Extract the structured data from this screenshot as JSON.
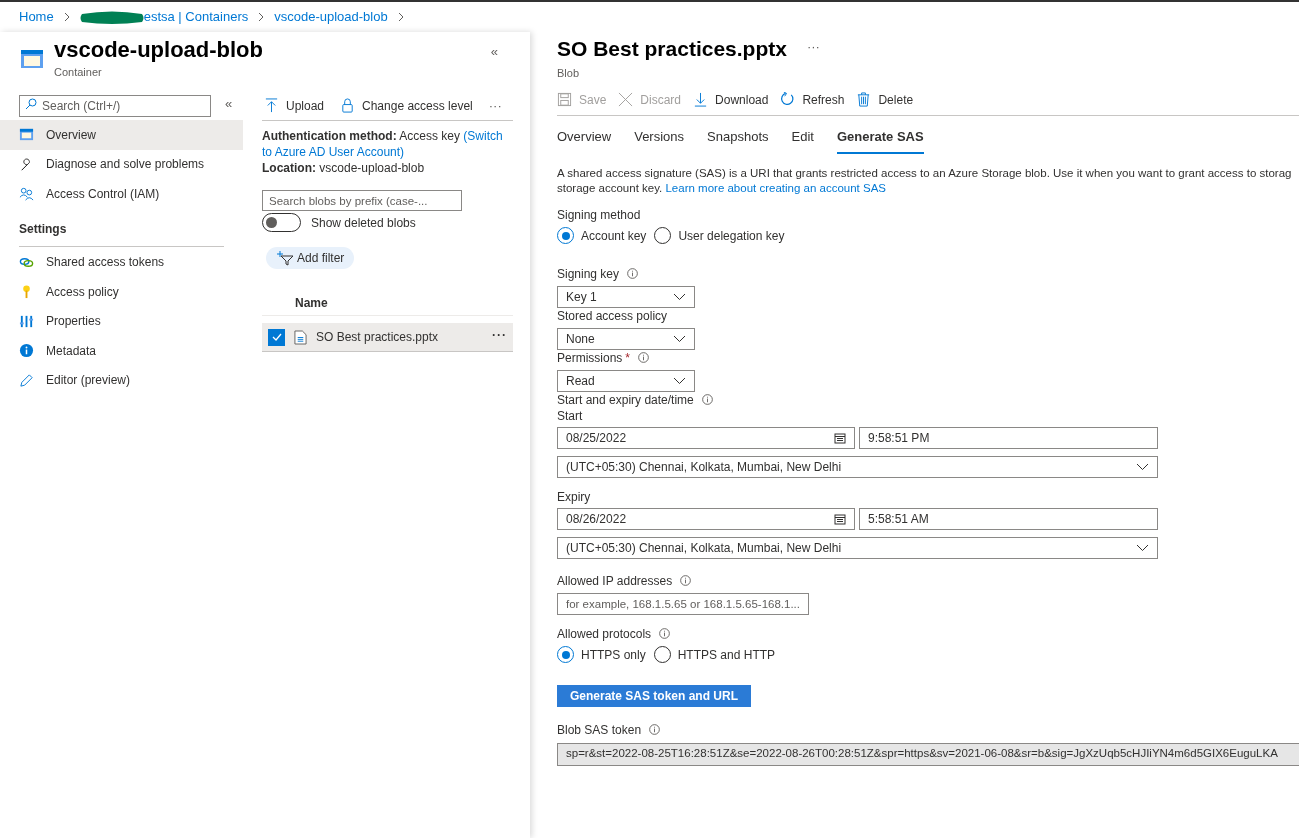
{
  "breadcrumb": [
    {
      "text": "Home",
      "redacted": false
    },
    {
      "text": "estsa | Containers",
      "redacted": true
    },
    {
      "text": "vscode-upload-blob",
      "redacted": false
    }
  ],
  "container": {
    "title": "vscode-upload-blob",
    "subtitle": "Container",
    "collapse": "«"
  },
  "sidebar": {
    "search": {
      "placeholder": "Search (Ctrl+/)"
    },
    "collapse": "«",
    "items": [
      {
        "label": "Overview",
        "selected": true
      },
      {
        "label": "Diagnose and solve problems",
        "selected": false
      },
      {
        "label": "Access Control (IAM)",
        "selected": false
      }
    ],
    "section": "Settings",
    "settings_items": [
      {
        "label": "Shared access tokens",
        "selected": false
      },
      {
        "label": "Access policy",
        "selected": false
      },
      {
        "label": "Properties",
        "selected": false
      },
      {
        "label": "Metadata",
        "selected": false
      },
      {
        "label": "Editor (preview)",
        "selected": false
      }
    ]
  },
  "container_toolbar": [
    {
      "label": "Upload"
    },
    {
      "label": "Change access level"
    }
  ],
  "container_toolbar_more": "···",
  "container_info": {
    "auth_label": "Authentication method:",
    "auth_value": "Access key",
    "auth_link": "(Switch to Azure AD User Account)",
    "location_label": "Location:",
    "location_value": "vscode-upload-blob"
  },
  "blob_search": {
    "placeholder": "Search blobs by prefix (case-..."
  },
  "show_deleted": {
    "label": "Show deleted blobs",
    "on": false
  },
  "add_filter": "Add filter",
  "blob_table": {
    "columns": [
      "Name"
    ],
    "rows": [
      {
        "name": "SO Best practices.pptx",
        "selected": true,
        "more": "···"
      }
    ]
  },
  "blob": {
    "title": "SO Best practices.pptx",
    "more": "···",
    "subtitle": "Blob"
  },
  "blob_toolbar": [
    {
      "label": "Save",
      "disabled": true
    },
    {
      "label": "Discard",
      "disabled": true
    },
    {
      "label": "Download",
      "disabled": false
    },
    {
      "label": "Refresh",
      "disabled": false
    },
    {
      "label": "Delete",
      "disabled": false
    }
  ],
  "tabs": [
    {
      "label": "Overview",
      "selected": false
    },
    {
      "label": "Versions",
      "selected": false
    },
    {
      "label": "Snapshots",
      "selected": false
    },
    {
      "label": "Edit",
      "selected": false
    },
    {
      "label": "Generate SAS",
      "selected": true
    }
  ],
  "description": {
    "line1": "A shared access signature (SAS) is a URI that grants restricted access to an Azure Storage blob. Use it when you want to grant access to storag",
    "line2": "storage account key.",
    "link": "Learn more about creating an account SAS"
  },
  "signing_method": {
    "label": "Signing method",
    "options": [
      {
        "label": "Account key",
        "selected": true
      },
      {
        "label": "User delegation key",
        "selected": false
      }
    ]
  },
  "signing_key": {
    "label": "Signing key",
    "value": "Key 1"
  },
  "stored_policy": {
    "label": "Stored access policy",
    "value": "None"
  },
  "permissions": {
    "label": "Permissions",
    "required": "*",
    "value": "Read"
  },
  "datetime_label": "Start and expiry date/time",
  "start": {
    "label": "Start",
    "date": "08/25/2022",
    "time": "9:58:51 PM",
    "timezone": "(UTC+05:30) Chennai, Kolkata, Mumbai, New Delhi"
  },
  "expiry": {
    "label": "Expiry",
    "date": "08/26/2022",
    "time": "5:58:51 AM",
    "timezone": "(UTC+05:30) Chennai, Kolkata, Mumbai, New Delhi"
  },
  "allowed_ip": {
    "label": "Allowed IP addresses",
    "placeholder": "for example, 168.1.5.65 or 168.1.5.65-168.1..."
  },
  "protocols": {
    "label": "Allowed protocols",
    "options": [
      {
        "label": "HTTPS only",
        "selected": true
      },
      {
        "label": "HTTPS and HTTP",
        "selected": false
      }
    ]
  },
  "generate_button": "Generate SAS token and URL",
  "sas_token": {
    "label": "Blob SAS token",
    "value": "sp=r&st=2022-08-25T16:28:51Z&se=2022-08-26T00:28:51Z&spr=https&sv=2021-06-08&sr=b&sig=JgXzUqb5cHJIiYN4m6d5GIX6EuguLKA"
  }
}
